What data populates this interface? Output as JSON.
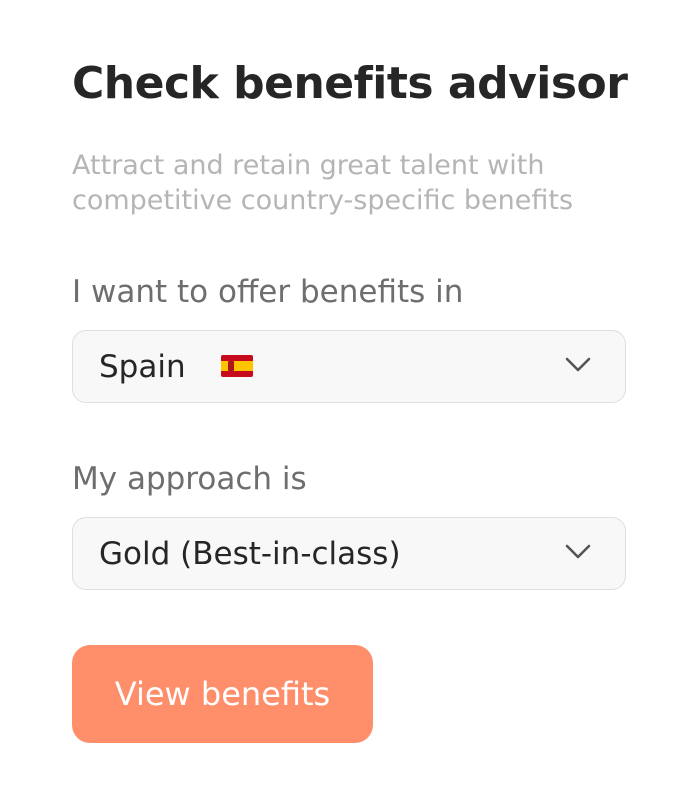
{
  "header": {
    "title": "Check benefits advisor",
    "subtitle": "Attract and retain great talent with competitive country-specific benefits"
  },
  "country_field": {
    "label": "I want to offer benefits in",
    "selected": "Spain",
    "flag_icon": "spain-flag-icon"
  },
  "approach_field": {
    "label": "My approach is",
    "selected": "Gold (Best-in-class)"
  },
  "actions": {
    "submit_label": "View benefits",
    "submit_color": "#ff8e6b"
  },
  "colors": {
    "title": "#262626",
    "subtitle": "#b5b5b5",
    "label": "#6e6e6e",
    "select_border": "#dedede",
    "select_bg": "#f8f8f8"
  }
}
